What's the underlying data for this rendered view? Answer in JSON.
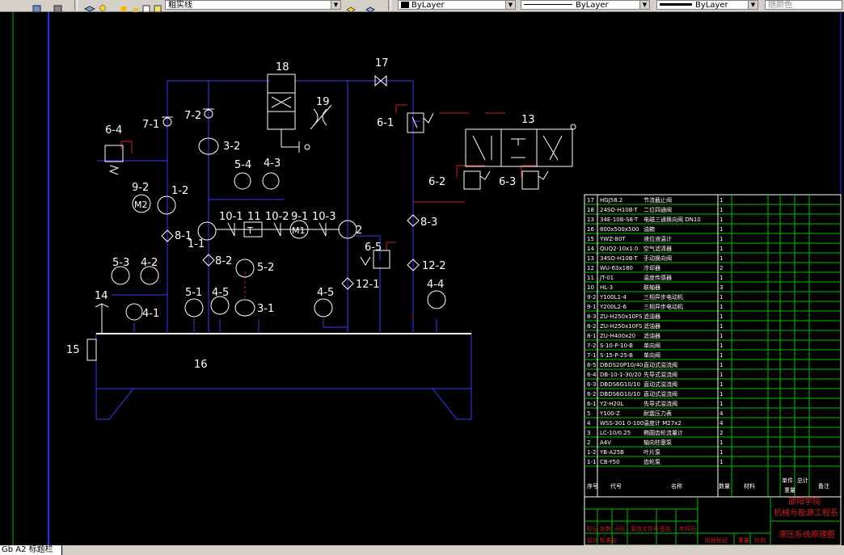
{
  "toolbar": {
    "linetype_combo": "粗实线",
    "color_combo": "ByLayer",
    "linetype2_combo": "ByLayer",
    "lineweight_combo": "ByLayer",
    "plotstyle_combo": "随颜色"
  },
  "status": {
    "layout_tab": "Gb A2 标题栏"
  },
  "drawing": {
    "labels": {
      "n18": "18",
      "n17": "17",
      "n19": "19",
      "n13": "13",
      "n6_1": "6-1",
      "n6_4": "6-4",
      "n6_2": "6-2",
      "n6_3": "6-3",
      "n6_5": "6-5",
      "n7_1": "7-1",
      "n7_2": "7-2",
      "n3_2": "3-2",
      "n5_4": "5-4",
      "n4_3": "4-3",
      "n9_2": "9-2",
      "m2": "M2",
      "n1_2": "1-2",
      "n8_1": "8-1",
      "n1_1": "1-1",
      "n10_1": "10-1",
      "n11": "11",
      "n10_2": "10-2",
      "n9_1": "9-1",
      "n10_3": "10-3",
      "m1": "M1",
      "t": "T",
      "n2": "2",
      "n8_3": "8-3",
      "n8_2": "8-2",
      "n5_2": "5-2",
      "n12_2": "12-2",
      "n12_1": "12-1",
      "n5_3": "5-3",
      "n4_2": "4-2",
      "n14": "14",
      "n5_1": "5-1",
      "n4_5a": "4-5",
      "n3_1": "3-1",
      "n4_5b": "4-5",
      "n4_4": "4-4",
      "n4_1": "4-1",
      "n15": "15",
      "n16": "16"
    },
    "bom_rows": [
      {
        "no": "17",
        "code": "HGJ58.2",
        "name": "节流截止阀",
        "qty": "1"
      },
      {
        "no": "18",
        "code": "24SO-H10B-T",
        "name": "二位四通阀",
        "qty": "1"
      },
      {
        "no": "13",
        "code": "34E-10B-S8-T",
        "name": "电磁三通换向阀 DN10",
        "qty": "1"
      },
      {
        "no": "16",
        "code": "800x500x500",
        "name": "油箱",
        "qty": "1"
      },
      {
        "no": "15",
        "code": "YWZ-80T",
        "name": "液位液温计",
        "qty": "1"
      },
      {
        "no": "14",
        "code": "QUQ2-10x1.0",
        "name": "空气滤清器",
        "qty": "1"
      },
      {
        "no": "13",
        "code": "34SO-H10B-T",
        "name": "手动换向阀",
        "qty": "1"
      },
      {
        "no": "12",
        "code": "WU-63x180",
        "name": "冷却器",
        "qty": "2"
      },
      {
        "no": "11",
        "code": "JT-01",
        "name": "温度传感器",
        "qty": "1"
      },
      {
        "no": "10",
        "code": "HL-3",
        "name": "联轴器",
        "qty": "3"
      },
      {
        "no": "9-2",
        "code": "Y100L1-4",
        "name": "三相异步电动机",
        "qty": "1"
      },
      {
        "no": "9-1",
        "code": "Y200L2-6",
        "name": "三相异步电动机",
        "qty": "1"
      },
      {
        "no": "8-3",
        "code": "ZU-H250x10FS",
        "name": "滤油器",
        "qty": "1"
      },
      {
        "no": "8-2",
        "code": "ZU-H250x10FS",
        "name": "滤油器",
        "qty": "1"
      },
      {
        "no": "8-1",
        "code": "ZU-H400x20",
        "name": "滤油器",
        "qty": "1"
      },
      {
        "no": "7-2",
        "code": "S-10-P-10-B",
        "name": "单向阀",
        "qty": "1"
      },
      {
        "no": "7-1",
        "code": "S-15-P-25-B",
        "name": "单向阀",
        "qty": "1"
      },
      {
        "no": "6-5",
        "code": "DBDS20P10/40",
        "name": "直动式溢流阀",
        "qty": "1"
      },
      {
        "no": "6-4",
        "code": "DB-10-1-30/20",
        "name": "先导式溢流阀",
        "qty": "1"
      },
      {
        "no": "6-3",
        "code": "DBDS6G10/10",
        "name": "直动式溢流阀",
        "qty": "1"
      },
      {
        "no": "6-2",
        "code": "DBDS6G10/10",
        "name": "直动式溢流阀",
        "qty": "1"
      },
      {
        "no": "6-1",
        "code": "Y2-H20L",
        "name": "先导式溢流阀",
        "qty": "1"
      },
      {
        "no": "5",
        "code": "Y100-Z",
        "name": "耐震压力表",
        "qty": "4"
      },
      {
        "no": "4",
        "code": "WSS-301 0-100",
        "name": "温度计 M27x2",
        "qty": "4"
      },
      {
        "no": "3",
        "code": "LC-10/0.25",
        "name": "椭圆齿轮流量计",
        "qty": "2"
      },
      {
        "no": "2",
        "code": "A4V",
        "name": "轴向柱塞泵",
        "qty": "1"
      },
      {
        "no": "1-2",
        "code": "YB-A25B",
        "name": "叶片泵",
        "qty": "1"
      },
      {
        "no": "1-1",
        "code": "CB-Y50",
        "name": "齿轮泵",
        "qty": "1"
      }
    ],
    "bom_header": {
      "no": "序号",
      "code": "代号",
      "name": "名称",
      "qty": "数量",
      "material": "材料",
      "unit_wt": "单件",
      "total_wt": "总计",
      "weight": "重量",
      "remark": "备注"
    },
    "title_block": {
      "school": "邵阳学院",
      "dept": "机械与能源工程系",
      "drawing_name": "液压系统原理图",
      "row1": [
        "标记",
        "处数",
        "分区",
        "更改文件号",
        "签名",
        "年月日"
      ],
      "row2": [
        "设计",
        "标准化",
        "",
        "",
        "阶段标记",
        "重量",
        "比例"
      ],
      "row3": [
        "审核",
        "",
        "工艺",
        "",
        "批准"
      ]
    }
  }
}
